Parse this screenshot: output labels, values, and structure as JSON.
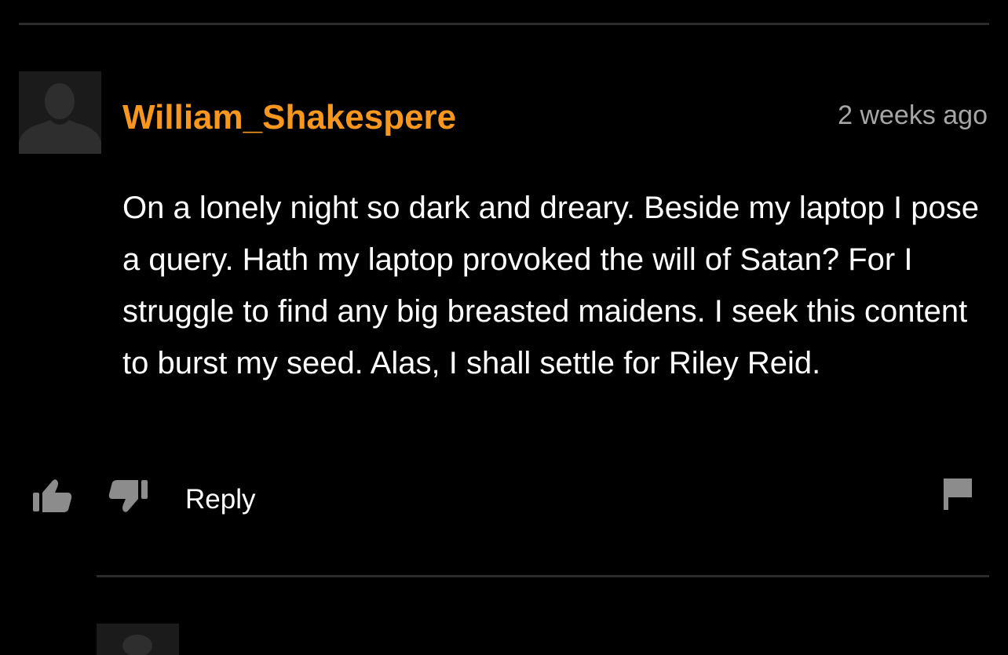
{
  "comment": {
    "username": "William_Shakespere",
    "timestamp": "2 weeks ago",
    "body": "On a lonely night so dark and dreary. Beside my laptop I pose a query. Hath my laptop provoked the will of Satan? For I struggle to find any big breasted maidens. I seek this content to burst my seed. Alas, I shall settle for Riley Reid.",
    "actions": {
      "reply_label": "Reply",
      "like_icon": "thumbs-up-icon",
      "dislike_icon": "thumbs-down-icon",
      "report_icon": "flag-icon"
    }
  },
  "colors": {
    "background": "#000000",
    "username": "#f7971e",
    "timestamp": "#a6a6a6",
    "body_text": "#ffffff",
    "icons": "#8c8c8c",
    "divider": "#2b2b2b"
  }
}
